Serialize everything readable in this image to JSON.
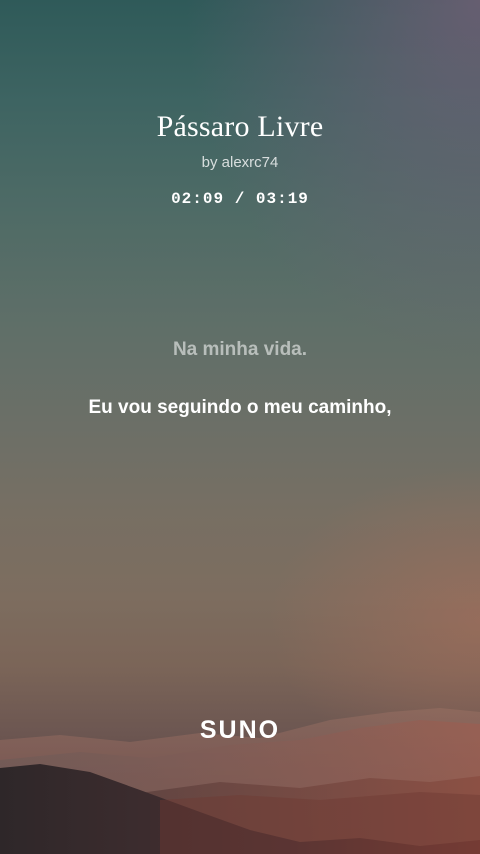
{
  "song": {
    "title": "Pássaro Livre",
    "artist": "by alexrc74",
    "time": "02:09 / 03:19"
  },
  "lyrics": {
    "previous": "Na minha vida.",
    "current": "Eu vou seguindo o meu caminho,"
  },
  "brand": {
    "logo_text": "SUNO"
  }
}
